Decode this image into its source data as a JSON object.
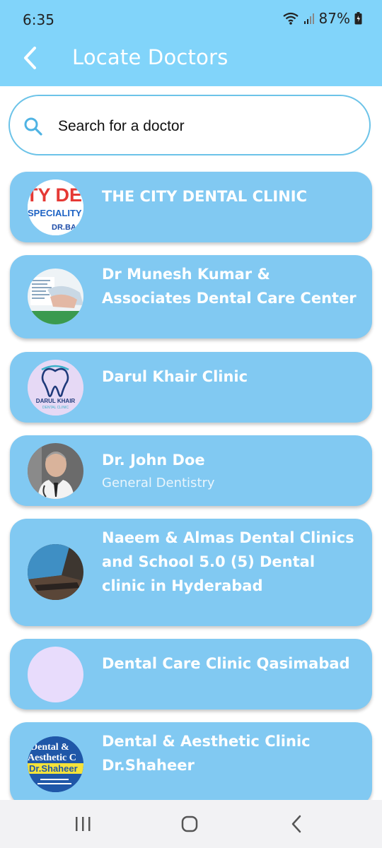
{
  "status_bar": {
    "time": "6:35",
    "battery": "87%"
  },
  "header": {
    "title": "Locate Doctors",
    "back_icon": "chevron-left-icon"
  },
  "search": {
    "placeholder": "Search for a doctor",
    "icon": "search-icon"
  },
  "doctors": [
    {
      "name": "THE CITY DENTAL CLINIC",
      "subtitle": "",
      "logo_text": [
        "TY DEN",
        "SPECIALITY DE",
        "DR.BAS"
      ]
    },
    {
      "name": "Dr Munesh Kumar & Associates Dental Care Center",
      "subtitle": ""
    },
    {
      "name": "Darul Khair Clinic",
      "subtitle": "",
      "logo_text": [
        "DARUL KHAIR",
        "DENTAL CLINIC"
      ]
    },
    {
      "name": "Dr. John Doe",
      "subtitle": "General Dentistry"
    },
    {
      "name": "Naeem & Almas Dental Clinics and School 5.0 (5)   Dental clinic in Hyderabad",
      "subtitle": ""
    },
    {
      "name": "Dental Care Clinic Qasimabad",
      "subtitle": ""
    },
    {
      "name": "Dental & Aesthetic Clinic Dr.Shaheer",
      "subtitle": "",
      "logo_text": [
        "Dental &",
        "Aesthetic C",
        "Dr.Shaheer"
      ]
    }
  ],
  "colors": {
    "header_bg": "#81d4fa",
    "card_bg": "#81c9f2",
    "search_border": "#6cc3e8",
    "placeholder_avatar": "#e8dcfc"
  },
  "nav_bar": {
    "icons": [
      "recent-apps-icon",
      "home-icon",
      "back-icon"
    ]
  }
}
